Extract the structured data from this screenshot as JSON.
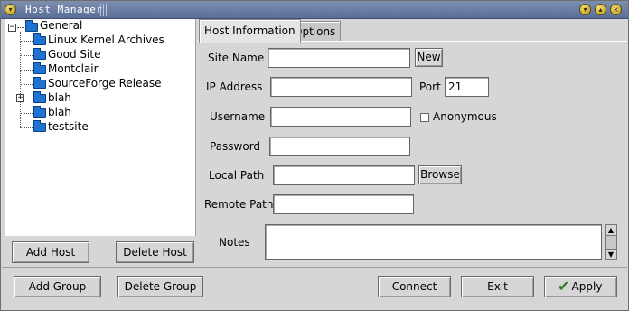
{
  "window": {
    "title": "Host Manager"
  },
  "tree": {
    "root_label": "General",
    "items": [
      {
        "label": "Linux Kernel Archives"
      },
      {
        "label": "Good Site"
      },
      {
        "label": "Montclair"
      },
      {
        "label": "SourceForge Release"
      },
      {
        "label": "blah"
      },
      {
        "label": "blah"
      },
      {
        "label": "testsite"
      }
    ],
    "expand_minus": "−",
    "expand_plus": "+"
  },
  "left_buttons": {
    "add_host": "Add Host",
    "delete_host": "Delete Host",
    "add_group": "Add Group",
    "delete_group": "Delete Group"
  },
  "tabs": [
    {
      "label": "Host Information",
      "active": true
    },
    {
      "label": "Options",
      "active": false
    }
  ],
  "form": {
    "site_name_label": "Site Name",
    "site_name_value": "",
    "new_button": "New",
    "ip_address_label": "IP Address",
    "ip_address_value": "",
    "port_label": "Port",
    "port_value": "21",
    "username_label": "Username",
    "username_value": "",
    "anonymous_label": "Anonymous",
    "anonymous_checked": false,
    "password_label": "Password",
    "password_value": "",
    "local_path_label": "Local Path",
    "local_path_value": "",
    "browse_button": "Browse",
    "remote_path_label": "Remote Path",
    "remote_path_value": "",
    "notes_label": "Notes",
    "notes_value": ""
  },
  "bottom_buttons": {
    "connect": "Connect",
    "exit": "Exit",
    "apply": "Apply"
  },
  "icons": {
    "window_menu": "window-menu-icon",
    "minimize": "minimize-icon",
    "maximize": "maximize-icon",
    "close": "close-icon",
    "folder": "folder-icon",
    "check": "checkmark-icon"
  },
  "colors": {
    "titlebar": "#5a6f98",
    "folder": "#1f73d2",
    "apply_check": "#2f7d1c"
  }
}
